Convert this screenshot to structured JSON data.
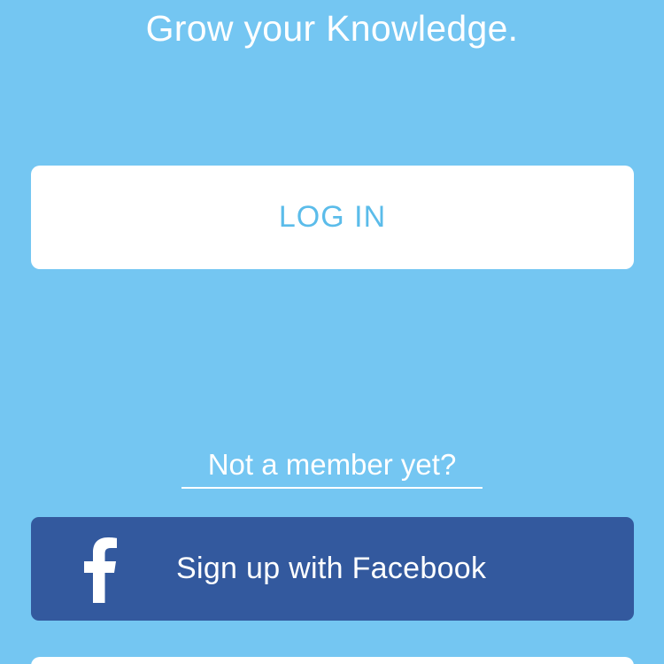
{
  "screen": {
    "tagline": "Grow your Knowledge.",
    "background_color": "#74c6f2"
  },
  "login": {
    "label": "LOG IN",
    "color": "#5bbcea"
  },
  "signup": {
    "prompt": "Not a member yet?"
  },
  "facebook": {
    "label": "Sign up with Facebook",
    "icon": "facebook-f-icon",
    "color": "#33599e"
  }
}
